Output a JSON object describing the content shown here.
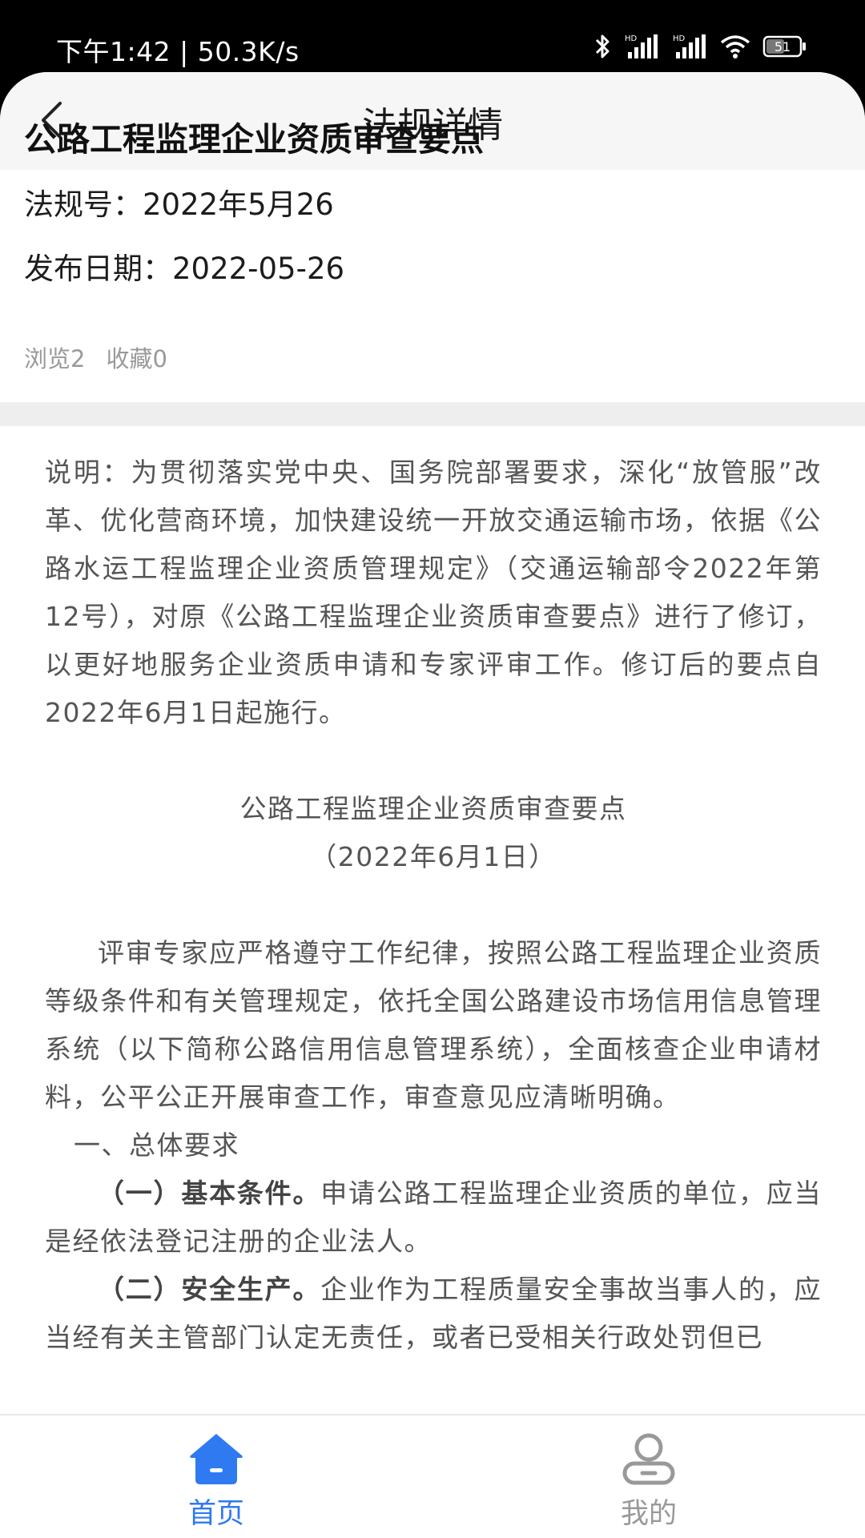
{
  "status_bar": {
    "time": "下午1:42 | 50.3K/s",
    "battery": "51",
    "icons": [
      "bluetooth-icon",
      "hd-signal-icon",
      "hd-signal-icon",
      "wifi-icon",
      "battery-icon"
    ]
  },
  "nav": {
    "title": "法规详情",
    "back_icon": "chevron-left-icon"
  },
  "doc": {
    "title": "公路工程监理企业资质审查要点",
    "number": "法规号：2022年5月26",
    "publish_date": "发布日期：2022-05-26",
    "views": "浏览2",
    "favorites": "收藏0"
  },
  "content": {
    "intro": "说明：为贯彻落实党中央、国务院部署要求，深化“放管服”改革、优化营商环境，加快建设统一开放交通运输市场，依据《公路水运工程监理企业资质管理规定》（交通运输部令2022年第12号），对原《公路工程监理企业资质审查要点》进行了修订，以更好地服务企业资质申请和专家评审工作。修订后的要点自2022年6月1日起施行。",
    "heading": "公路工程监理企业资质审查要点",
    "heading_date": "（2022年6月1日）",
    "para1": "评审专家应严格遵守工作纪律，按照公路工程监理企业资质等级条件和有关管理规定，依托全国公路建设市场信用信息管理系统（以下简称公路信用信息管理系统），全面核查企业申请材料，公平公正开展审查工作，审查意见应清晰明确。",
    "section1": "一、总体要求",
    "item1_lead": "（一）基本条件。",
    "item1_text": "申请公路工程监理企业资质的单位，应当是经依法登记注册的企业法人。",
    "item2_lead": "（二）安全生产。",
    "item2_text": "企业作为工程质量安全事故当事人的，应当经有关主管部门认定无责任，或者已受相关行政处罚但已"
  },
  "tabs": [
    {
      "label": "首页",
      "icon": "home-icon",
      "active": true
    },
    {
      "label": "我的",
      "icon": "user-icon",
      "active": false
    }
  ],
  "colors": {
    "accent": "#2f7af0",
    "inactive": "#999999",
    "body_text": "#555555"
  }
}
